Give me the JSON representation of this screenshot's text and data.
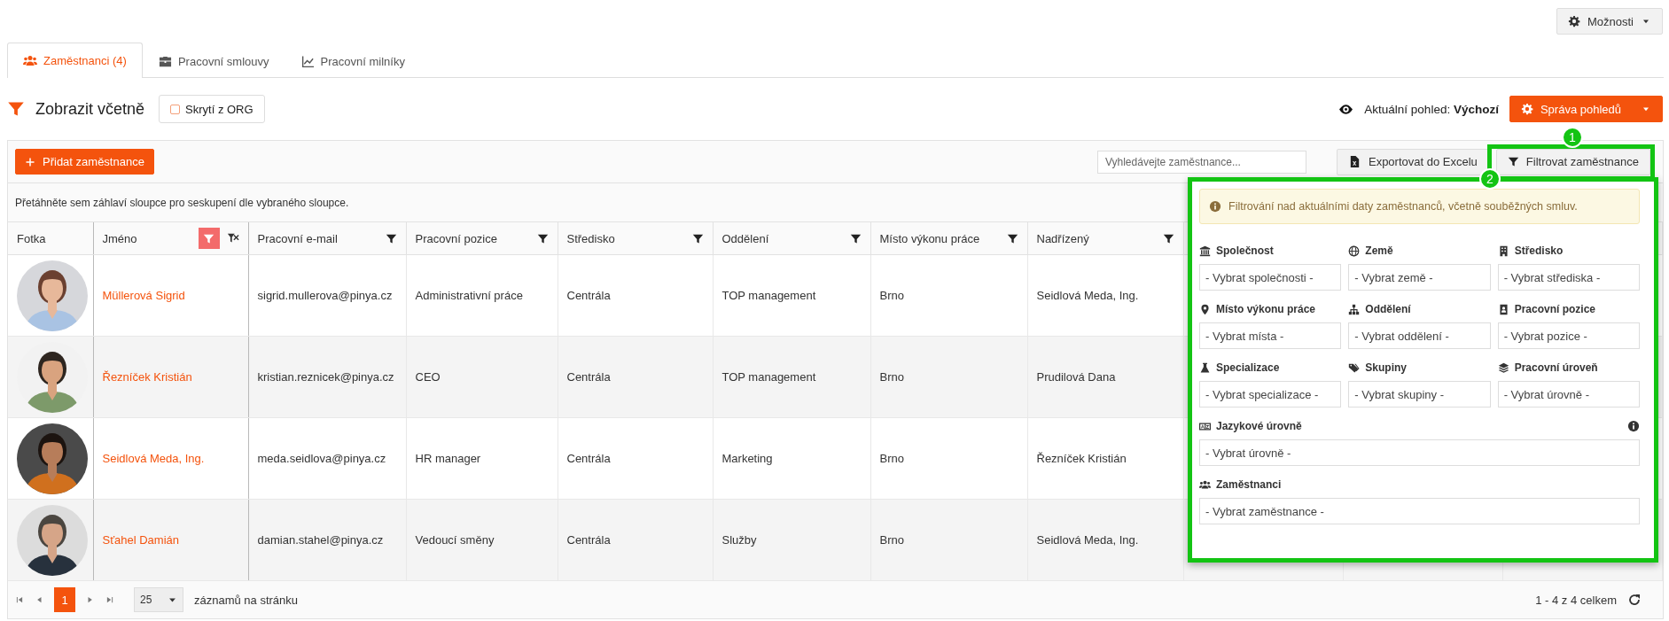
{
  "options_button": {
    "label": "Možnosti"
  },
  "tabs": [
    {
      "label": "Zaměstnanci (4)",
      "selected": true
    },
    {
      "label": "Pracovní smlouvy",
      "selected": false
    },
    {
      "label": "Pracovní milníky",
      "selected": false
    }
  ],
  "view_bar": {
    "title": "Zobrazit včetně",
    "toggle": {
      "label": "Skrytí z ORG",
      "checked": false
    },
    "current_view": "Aktuální pohled: **Výchozí**",
    "manage_button": "Správa pohledů"
  },
  "toolbar": {
    "add_button": "Přidat zaměstnance",
    "search": {
      "placeholder": "Vyhledávejte zaměstnance..."
    },
    "export_button": "Exportovat do Excelu",
    "filter_button": "Filtrovat zaměstnance"
  },
  "group_hint": "Přetáhněte sem záhlaví sloupce pro seskupení dle vybraného sloupce.",
  "table": {
    "columns": [
      {
        "label": "Fotka",
        "filterable": false,
        "filter_active": false
      },
      {
        "label": "Jméno",
        "kind": "link",
        "filterable": true,
        "filter_active": true
      },
      {
        "label": "Pracovní e-mail",
        "kind": "text",
        "filterable": true,
        "filter_active": false
      },
      {
        "label": "Pracovní pozice",
        "kind": "text",
        "filterable": true,
        "filter_active": false
      },
      {
        "label": "Středisko",
        "kind": "text",
        "filterable": true,
        "filter_active": false
      },
      {
        "label": "Oddělení",
        "kind": "text",
        "filterable": true,
        "filter_active": false
      },
      {
        "label": "Místo výkonu práce",
        "kind": "text",
        "filterable": true,
        "filter_active": false
      },
      {
        "label": "Nadřízený",
        "kind": "text",
        "filterable": true,
        "filter_active": false
      }
    ],
    "rows": [
      {
        "cells": [
          {
            "kind": "picture"
          },
          "Müllerová Sigrid",
          "sigrid.mullerova@pinya.cz",
          "Administrativní práce",
          "Centrála",
          "TOP management",
          "Brno",
          "Seidlová Meda, Ing."
        ]
      },
      {
        "cells": [
          {
            "kind": "picture"
          },
          "Řezníček Kristián",
          "kristian.reznicek@pinya.cz",
          "CEO",
          "Centrála",
          "TOP management",
          "Brno",
          "Prudilová Dana"
        ]
      },
      {
        "cells": [
          {
            "kind": "picture"
          },
          "Seidlová Meda, Ing.",
          "meda.seidlova@pinya.cz",
          "HR manager",
          "Centrála",
          "Marketing",
          "Brno",
          "Řezníček Kristián"
        ]
      },
      {
        "cells": [
          {
            "kind": "picture"
          },
          "Sťahel Damián",
          "damian.stahel@pinya.cz",
          "Vedoucí směny",
          "Centrála",
          "Služby",
          "Brno",
          "Seidlová Meda, Ing."
        ]
      }
    ]
  },
  "pager": {
    "pages": [
      {
        "label": "1",
        "selected": true
      }
    ],
    "page_size": "25",
    "page_size_label": "záznamů na stránku",
    "summary": "1 - 4 z 4 celkem"
  },
  "filter_panel": {
    "notice": "Filtrování nad aktuálními daty zaměstnanců, včetně souběžných smluv.",
    "fields": [
      {
        "label": "Společnost",
        "placeholder": "- Vybrat společnosti -",
        "wide": false,
        "info": false
      },
      {
        "label": "Země",
        "placeholder": "- Vybrat země -",
        "wide": false,
        "info": false
      },
      {
        "label": "Středisko",
        "placeholder": "- Vybrat střediska -",
        "wide": false,
        "info": false
      },
      {
        "label": "Místo výkonu práce",
        "placeholder": "- Vybrat místa -",
        "wide": false,
        "info": false
      },
      {
        "label": "Oddělení",
        "placeholder": "- Vybrat oddělení -",
        "wide": false,
        "info": false
      },
      {
        "label": "Pracovní pozice",
        "placeholder": "- Vybrat pozice -",
        "wide": false,
        "info": false
      },
      {
        "label": "Specializace",
        "placeholder": "- Vybrat specializace -",
        "wide": false,
        "info": false
      },
      {
        "label": "Skupiny",
        "placeholder": "- Vybrat skupiny -",
        "wide": false,
        "info": false
      },
      {
        "label": "Pracovní úroveň",
        "placeholder": "- Vybrat úrovně -",
        "wide": false,
        "info": false
      },
      {
        "label": "Jazykové úrovně",
        "placeholder": "- Vybrat úrovně -",
        "wide": true,
        "info": true
      },
      {
        "label": "Zaměstnanci",
        "placeholder": "- Vybrat zaměstnance -",
        "wide": true,
        "info": false
      }
    ]
  },
  "annotations": [
    {
      "label": "1"
    },
    {
      "label": "2"
    }
  ]
}
